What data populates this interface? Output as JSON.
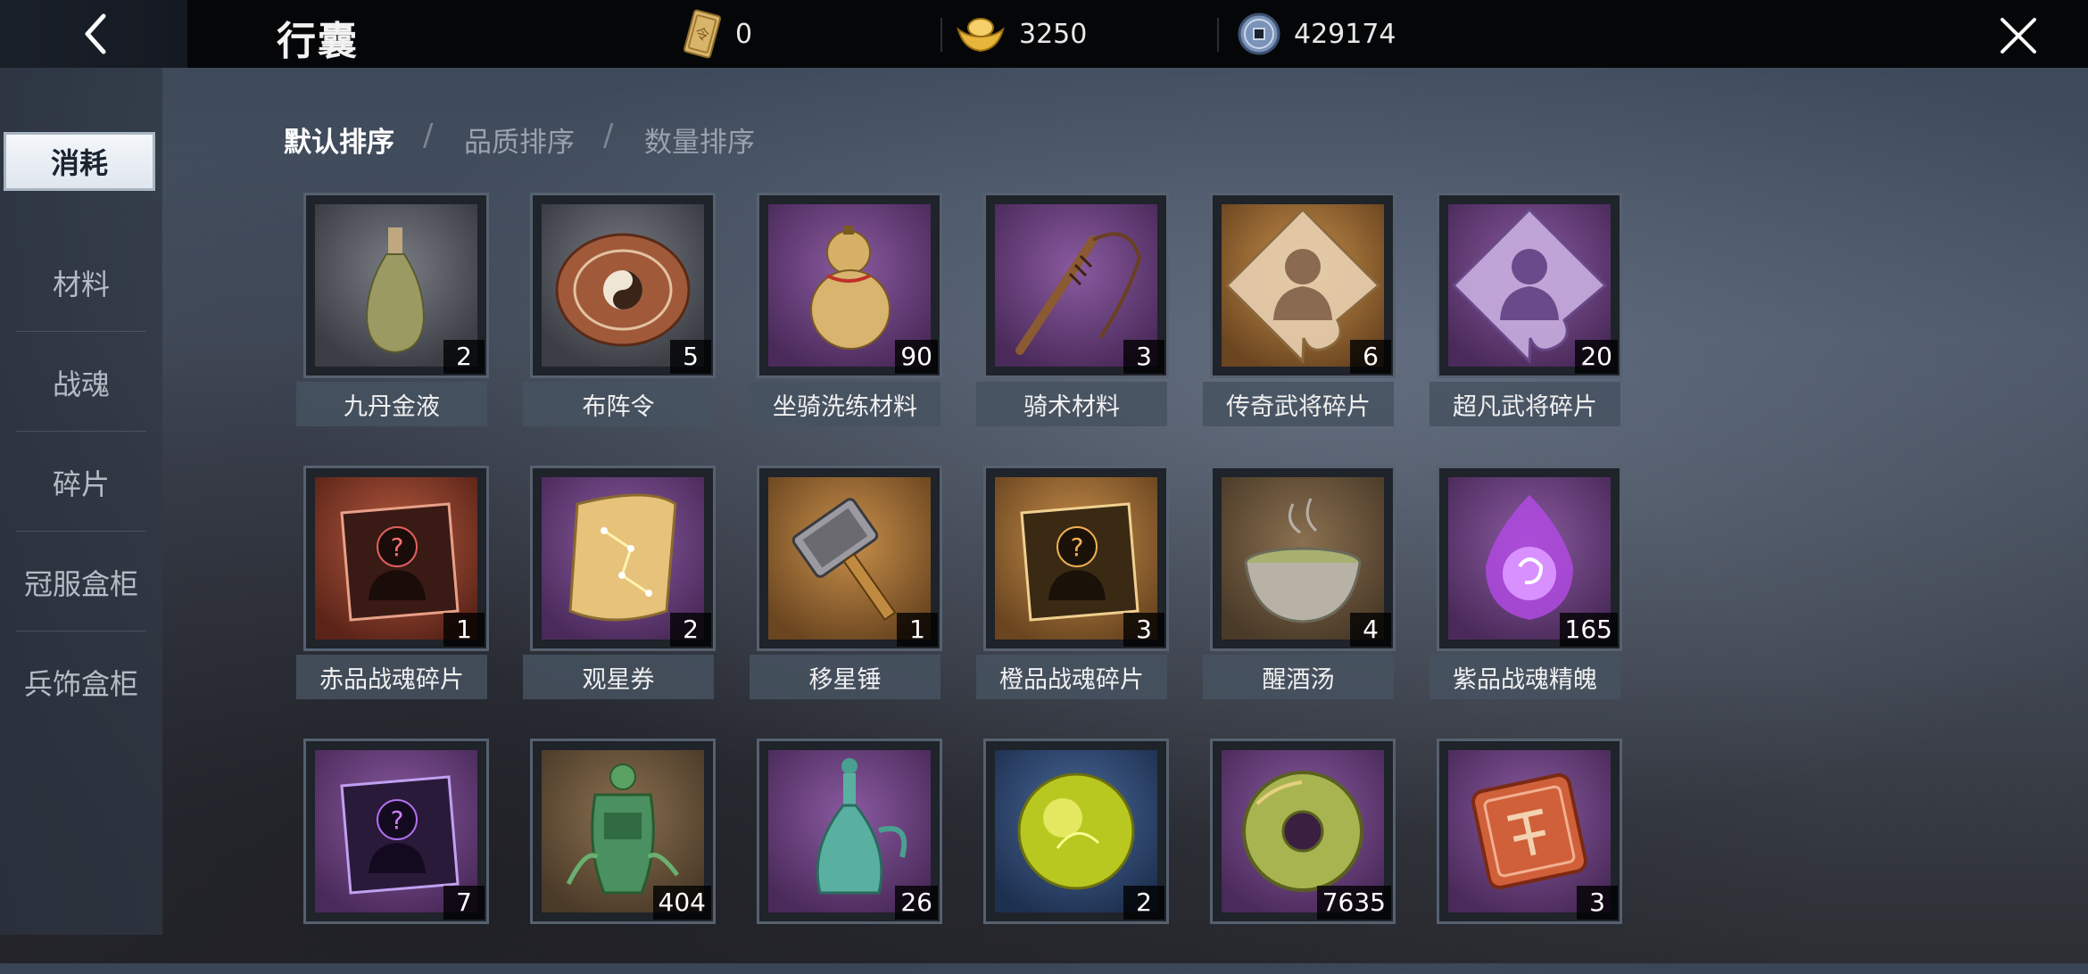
{
  "header": {
    "title": "行囊",
    "currencies": [
      {
        "icon": "token-icon",
        "value": "0"
      },
      {
        "icon": "gold-ingot-icon",
        "value": "3250"
      },
      {
        "icon": "copper-coin-icon",
        "value": "429174"
      }
    ]
  },
  "sidebar": {
    "items": [
      {
        "label": "消耗"
      },
      {
        "label": "材料"
      },
      {
        "label": "战魂"
      },
      {
        "label": "碎片"
      },
      {
        "label": "冠服盒柜"
      },
      {
        "label": "兵饰盒柜"
      }
    ]
  },
  "sort": {
    "options": [
      {
        "label": "默认排序"
      },
      {
        "label": "品质排序"
      },
      {
        "label": "数量排序"
      }
    ],
    "separator": "/"
  },
  "items": [
    {
      "name": "九丹金液",
      "count": "2",
      "icon": "vase-icon"
    },
    {
      "name": "布阵令",
      "count": "5",
      "icon": "bagua-disc-icon"
    },
    {
      "name": "坐骑洗练材料",
      "count": "90",
      "icon": "gourd-icon"
    },
    {
      "name": "骑术材料",
      "count": "3",
      "icon": "whip-icon"
    },
    {
      "name": "传奇武将碎片",
      "count": "6",
      "icon": "general-fragment-icon"
    },
    {
      "name": "超凡武将碎片",
      "count": "20",
      "icon": "general-fragment-icon"
    },
    {
      "name": "赤品战魂碎片",
      "count": "1",
      "icon": "soul-fragment-icon"
    },
    {
      "name": "观星券",
      "count": "2",
      "icon": "scroll-icon"
    },
    {
      "name": "移星锤",
      "count": "1",
      "icon": "hammer-icon"
    },
    {
      "name": "橙品战魂碎片",
      "count": "3",
      "icon": "soul-fragment-icon"
    },
    {
      "name": "醒酒汤",
      "count": "4",
      "icon": "tea-bowl-icon"
    },
    {
      "name": "紫品战魂精魄",
      "count": "165",
      "icon": "purple-flame-icon"
    },
    {
      "name": "",
      "count": "7",
      "icon": "soul-fragment-icon"
    },
    {
      "name": "",
      "count": "404",
      "icon": "jade-censer-icon"
    },
    {
      "name": "",
      "count": "26",
      "icon": "celadon-ewer-icon"
    },
    {
      "name": "",
      "count": "2",
      "icon": "jade-orb-icon"
    },
    {
      "name": "",
      "count": "7635",
      "icon": "jade-bi-disc-icon"
    },
    {
      "name": "",
      "count": "3",
      "icon": "token-plaque-icon"
    }
  ]
}
